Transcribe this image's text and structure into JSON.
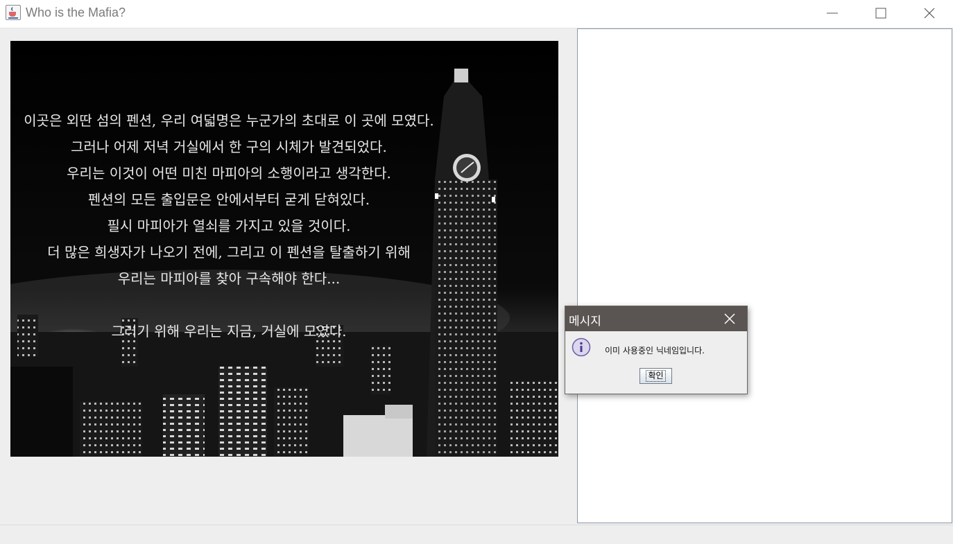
{
  "window": {
    "title": "Who is the Mafia?",
    "icon": "java-cup-icon",
    "controls": [
      "minimize-icon",
      "maximize-icon",
      "close-icon"
    ]
  },
  "story": {
    "lines": [
      "이곳은 외딴 섬의 펜션, 우리 여덟명은 누군가의 초대로 이 곳에 모였다.",
      "그러나 어제 저녁 거실에서 한 구의 시체가 발견되었다.",
      "우리는 이것이 어떤 미친 마피아의 소행이라고 생각한다.",
      "펜션의 모든 출입문은 안에서부터 굳게 닫혀있다.",
      "필시 마피아가 열쇠를 가지고 있을 것이다.",
      "더 많은 희생자가 나오기 전에, 그리고 이 펜션을 탈출하기 위해",
      "우리는 마피아를 찾아 구속해야 한다...",
      "",
      "그러기 위해 우리는 지금, 거실에 모였다."
    ]
  },
  "dialog": {
    "title": "메시지",
    "icon": "info-icon",
    "message": "이미 사용중인 닉네임입니다.",
    "ok_label": "확인"
  },
  "colors": {
    "background": "#eeeeee",
    "dialog_titlebar": "#5a5552",
    "side_panel": "#ffffff",
    "story_text": "#e8e8e8"
  }
}
